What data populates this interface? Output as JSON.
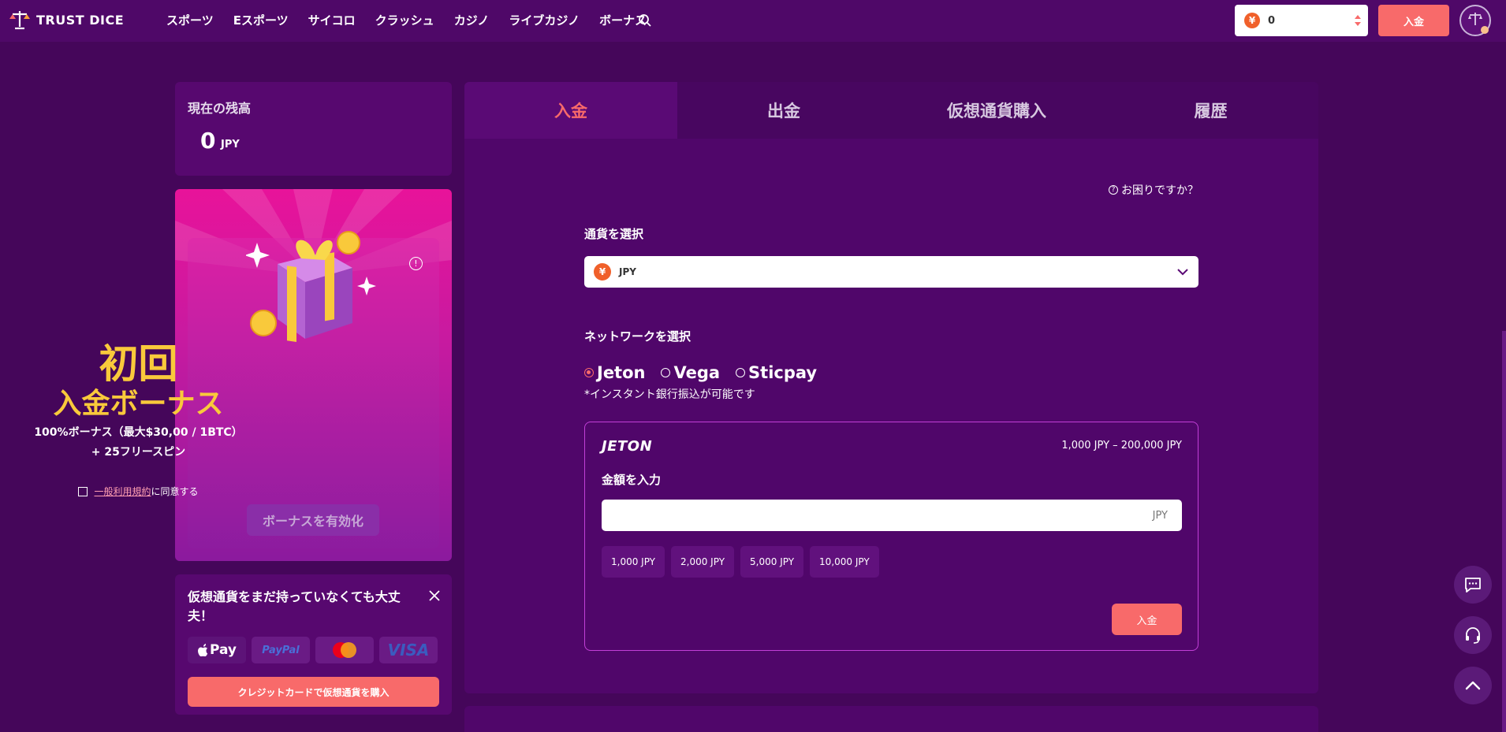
{
  "header": {
    "logo_text": "TRUST DICE",
    "nav": [
      "スポーツ",
      "Eスポーツ",
      "サイコロ",
      "クラッシュ",
      "カジノ",
      "ライブカジノ",
      "ボーナス"
    ],
    "balance": "0",
    "currency_symbol": "¥",
    "deposit_label": "入金"
  },
  "sidebar": {
    "balance_title": "現在の残高",
    "balance_amount": "0",
    "balance_unit": "JPY",
    "bonus": {
      "title1": "初回",
      "title2": "入金ボーナス",
      "desc1": "100%ボーナス（最大$30,00 / 1BTC）",
      "desc2": "+ 25フリースピン",
      "terms_link": "一般利用規約",
      "terms_suffix": "に同意する",
      "activate_label": "ボーナスを有効化"
    },
    "crypto": {
      "title": "仮想通貨をまだ持っていなくても大丈夫！",
      "payments": [
        "Pay",
        "PayPal",
        "",
        "VISA"
      ],
      "buy_label": "クレジットカードで仮想通貨を購入"
    }
  },
  "main": {
    "tabs": [
      "入金",
      "出金",
      "仮想通貨購入",
      "履歴"
    ],
    "active_tab": 0,
    "help": "お困りですか？",
    "currency_label": "通貨を選択",
    "currency_value": "JPY",
    "network_label": "ネットワークを選択",
    "networks": [
      "Jeton",
      "Vega",
      "Sticpay"
    ],
    "selected_network": "Jeton",
    "network_note": "*インスタント銀行振込が可能です",
    "jeton": {
      "logo": "JETON",
      "range": "1,000 JPY – 200,000 JPY",
      "amount_label": "金額を入力",
      "amount_value": "",
      "amount_unit": "JPY",
      "presets": [
        "1,000 JPY",
        "2,000 JPY",
        "5,000 JPY",
        "10,000 JPY"
      ],
      "submit_label": "入金"
    }
  },
  "colors": {
    "accent": "#f86a6a",
    "bg": "#45065a",
    "panel": "#50066a",
    "gold": "#f9c93b"
  }
}
